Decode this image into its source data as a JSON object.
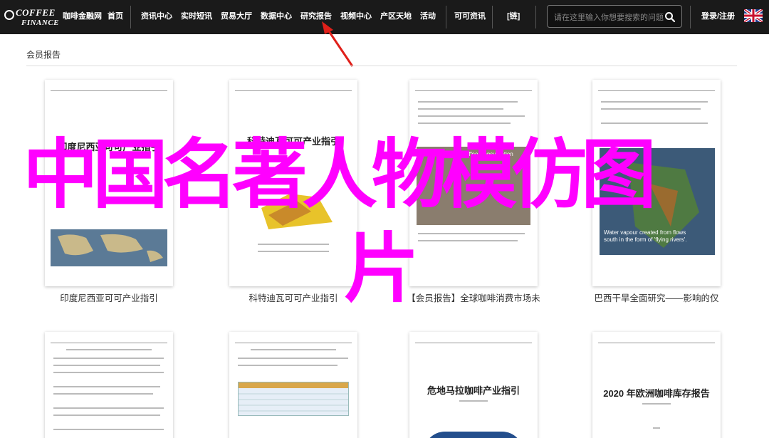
{
  "logo": {
    "line1": "COFFEE",
    "line2": "FINANCE"
  },
  "nav": {
    "items": [
      "咖啡金融网",
      "首页",
      "资讯中心",
      "实时短讯",
      "贸易大厅",
      "数据中心",
      "研究报告",
      "视频中心",
      "产区天地",
      "活动",
      "可可资讯",
      "[链]"
    ],
    "login": "登录/注册"
  },
  "search": {
    "placeholder": "请在这里输入你想要搜索的问题"
  },
  "section": {
    "title": "会员报告"
  },
  "cards_row1": [
    {
      "caption": "印度尼西亚可可产业指引",
      "doc_title": "印度尼西亚可可产业指引"
    },
    {
      "caption": "科特迪瓦可可产业指引",
      "doc_title": "科特迪瓦可可产业指引"
    },
    {
      "caption": "【会员报告】全球咖啡消费市场未",
      "doc_title": "",
      "img_text": "World Coffee Consumption"
    },
    {
      "caption": "巴西干旱全面研究——影响的仅",
      "doc_title": "",
      "img_text1": "Water vapour created from flows",
      "img_text2": "south in the form of 'flying rivers'."
    }
  ],
  "cards_row2": [
    {
      "doc_title": ""
    },
    {
      "doc_title": ""
    },
    {
      "doc_title": "危地马拉咖啡产业指引"
    },
    {
      "doc_title": "2020 年欧洲咖啡库存报告"
    }
  ],
  "overlay": {
    "line1": "中国名著人物模仿图",
    "line2": "片"
  },
  "colors": {
    "nav_bg": "#1a1a1a",
    "overlay": "#ff00ff",
    "arrow": "#e0201a"
  }
}
